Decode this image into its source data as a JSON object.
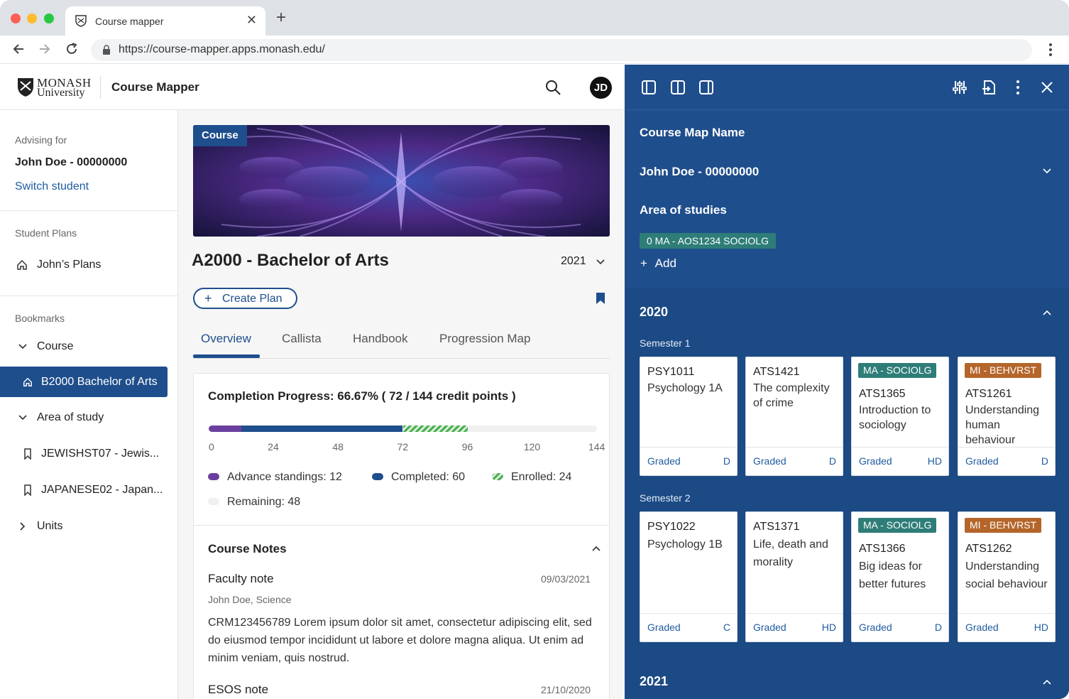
{
  "browser": {
    "tab_title": "Course mapper",
    "url": "https://course-mapper.apps.monash.edu/"
  },
  "header": {
    "logo_line1": "MONASH",
    "logo_line2": "University",
    "app_title": "Course Mapper",
    "avatar_initials": "JD"
  },
  "sidebar": {
    "advising_label": "Advising for",
    "student_name": "John Doe - 00000000",
    "switch_link": "Switch student",
    "plans_label": "Student Plans",
    "plans_item": "John’s Plans",
    "bookmarks_label": "Bookmarks",
    "course_group": "Course",
    "active_course": "B2000 Bachelor of Arts",
    "aos_group": "Area of study",
    "aos_items": [
      "JEWISHST07 - Jewis...",
      "JAPANESE02 - Japan..."
    ],
    "units_group": "Units"
  },
  "main": {
    "hero_tag": "Course",
    "course_title": "A2000 - Bachelor of Arts",
    "year": "2021",
    "create_plan": "Create Plan",
    "tabs": [
      "Overview",
      "Callista",
      "Handbook",
      "Progression Map"
    ],
    "completion_title": "Completion Progress: 66.67% ( 72  / 144 credit points )",
    "progress": {
      "total": 144,
      "advance": 12,
      "completed": 60,
      "enrolled": 24,
      "remaining": 48,
      "ticks": [
        "0",
        "24",
        "48",
        "72",
        "96",
        "120",
        "144"
      ]
    },
    "legend": {
      "advance": "Advance standings: 12",
      "completed": "Completed: 60",
      "enrolled": "Enrolled: 24",
      "remaining": "Remaining: 48"
    },
    "notes_title": "Course Notes",
    "notes": [
      {
        "title": "Faculty note",
        "date": "09/03/2021",
        "author": "John Doe, Science",
        "body": "CRM123456789 Lorem ipsum dolor sit amet, consectetur adipiscing elit, sed do eiusmod tempor incididunt ut labore et dolore magna aliqua. Ut enim ad minim veniam, quis nostrud."
      },
      {
        "title": "ESOS note",
        "date": "21/10/2020"
      }
    ]
  },
  "panel": {
    "map_name_label": "Course Map Name",
    "student": "John Doe - 00000000",
    "aos_label": "Area of studies",
    "aos_chip": "0  MA - AOS1234 SOCIOLG",
    "add_label": "Add",
    "years": [
      {
        "year": "2020",
        "semesters": [
          {
            "label": "Semester 1",
            "units": [
              {
                "badge": "",
                "code": "PSY1011",
                "name": "Psychology 1A",
                "status": "Graded",
                "grade": "D"
              },
              {
                "badge": "",
                "code": "ATS1421",
                "name": "The complexity of crime",
                "status": "Graded",
                "grade": "D"
              },
              {
                "badge": "MA - SOCIOLG",
                "code": "ATS1365",
                "name": "Introduction to sociology",
                "status": "Graded",
                "grade": "HD"
              },
              {
                "badge": "MI - BEHVRST",
                "code": "ATS1261",
                "name": "Understanding human behaviour",
                "status": "Graded",
                "grade": "D"
              }
            ]
          },
          {
            "label": "Semester 2",
            "units": [
              {
                "badge": "",
                "code": "PSY1022",
                "name": "Psychology 1B",
                "status": "Graded",
                "grade": "C"
              },
              {
                "badge": "",
                "code": "ATS1371",
                "name": "Life, death and morality",
                "status": "Graded",
                "grade": "HD"
              },
              {
                "badge": "MA - SOCIOLG",
                "code": "ATS1366",
                "name": "Big ideas for better futures",
                "status": "Graded",
                "grade": "D"
              },
              {
                "badge": "MI - BEHVRST",
                "code": "ATS1262",
                "name": "Understanding social behaviour",
                "status": "Graded",
                "grade": "HD"
              }
            ]
          }
        ]
      },
      {
        "year": "2021"
      }
    ]
  },
  "colors": {
    "primary": "#1f4e8c",
    "advance": "#6b3fa0",
    "completed": "#1f4e8c",
    "enrolled": "#4caf50",
    "sociolg_badge": "#2e7d78",
    "behvrst_badge": "#b5652a"
  }
}
